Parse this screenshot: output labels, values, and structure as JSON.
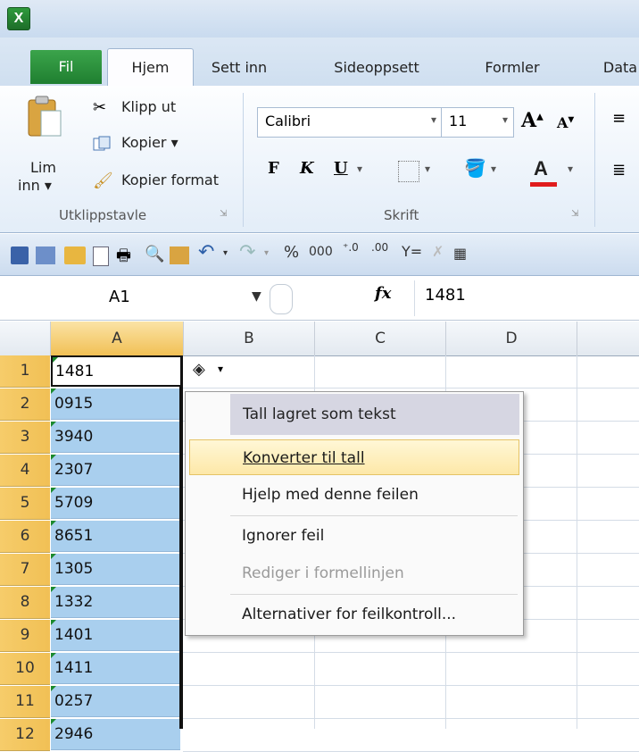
{
  "ribbon_tabs": [
    "Fil",
    "Hjem",
    "Sett inn",
    "Sideoppsett",
    "Formler",
    "Data"
  ],
  "clipboard": {
    "paste_label_1": "Lim",
    "paste_label_2": "inn ▾",
    "cut": "Klipp ut",
    "copy": "Kopier ▾",
    "format_painter": "Kopier format",
    "group_label": "Utklippstavle"
  },
  "font": {
    "name": "Calibri",
    "size": "11",
    "bold": "F",
    "italic": "K",
    "underline": "U",
    "group_label": "Skrift"
  },
  "formula_bar": {
    "name_box": "A1",
    "fx": "fx",
    "value": "1481"
  },
  "columns": [
    "A",
    "B",
    "C",
    "D"
  ],
  "rows": [
    {
      "num": "1",
      "value": "1481"
    },
    {
      "num": "2",
      "value": "0915"
    },
    {
      "num": "3",
      "value": "3940"
    },
    {
      "num": "4",
      "value": "2307"
    },
    {
      "num": "5",
      "value": "5709"
    },
    {
      "num": "6",
      "value": "8651"
    },
    {
      "num": "7",
      "value": "1305"
    },
    {
      "num": "8",
      "value": "1332"
    },
    {
      "num": "9",
      "value": "1401"
    },
    {
      "num": "10",
      "value": "1411"
    },
    {
      "num": "11",
      "value": "0257"
    },
    {
      "num": "12",
      "value": "2946"
    }
  ],
  "error_menu": {
    "title": "Tall lagret som tekst",
    "items": [
      {
        "label": "Konverter til tall",
        "enabled": true,
        "highlighted": true
      },
      {
        "label": "Hjelp med denne feilen",
        "enabled": true
      },
      {
        "label": "Ignorer feil",
        "enabled": true
      },
      {
        "label": "Rediger i formellinjen",
        "enabled": false
      },
      {
        "label": "Alternativer for feilkontroll...",
        "enabled": true
      }
    ]
  },
  "colors": {
    "selection": "#a9cfee",
    "row_header_selected": "#f1c055",
    "error_triangle": "#1b8a2e",
    "menu_highlight": "#fde8a8"
  },
  "icons": [
    "excel-icon",
    "paste-icon",
    "cut-icon",
    "copy-icon",
    "format-painter-icon",
    "save-icon",
    "undo-icon",
    "redo-icon",
    "warning-icon"
  ]
}
